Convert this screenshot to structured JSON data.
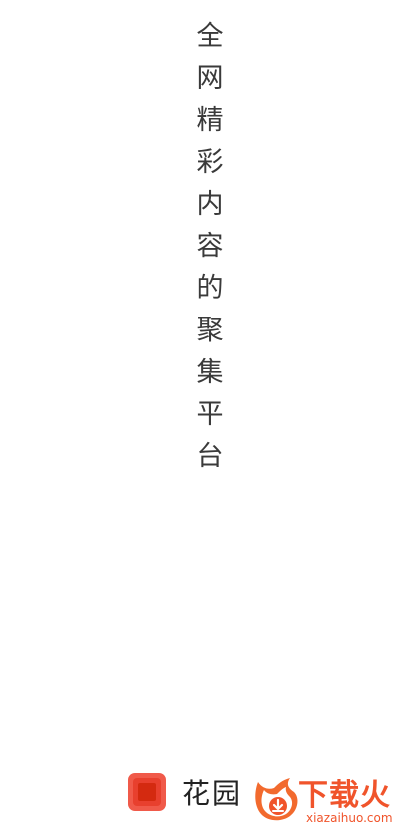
{
  "splash": {
    "slogan_chars": [
      "全",
      "网",
      "精",
      "彩",
      "内",
      "容",
      "的",
      "聚",
      "集",
      "平",
      "台"
    ]
  },
  "footer": {
    "app_logo_icon": "red-square-app-icon",
    "app_name": "花园"
  },
  "watermark": {
    "logo_icon": "fire-download-icon",
    "title": "下载火",
    "url": "xiazaihuo.com",
    "color": "#f0542b"
  }
}
